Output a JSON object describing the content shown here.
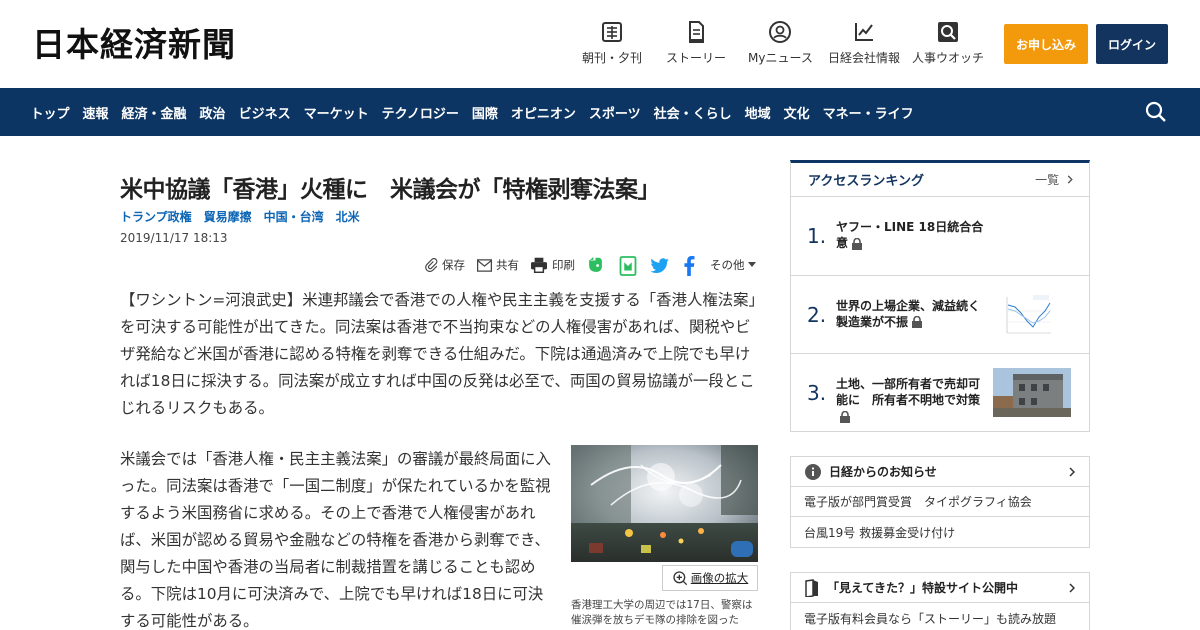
{
  "header": {
    "logo": "日本経済新聞",
    "nav": [
      {
        "label": "朝刊・夕刊",
        "icon": "newspaper-icon"
      },
      {
        "label": "ストーリー",
        "icon": "story-icon"
      },
      {
        "label": "Myニュース",
        "icon": "user-icon"
      },
      {
        "label": "日経会社情報",
        "icon": "chart-icon"
      },
      {
        "label": "人事ウオッチ",
        "icon": "people-search-icon"
      }
    ],
    "apply_label": "お申し込み",
    "login_label": "ログイン"
  },
  "navbar": {
    "items": [
      "トップ",
      "速報",
      "経済・金融",
      "政治",
      "ビジネス",
      "マーケット",
      "テクノロジー",
      "国際",
      "オピニオン",
      "スポーツ",
      "社会・くらし",
      "地域",
      "文化",
      "マネー・ライフ"
    ]
  },
  "article": {
    "title": "米中協議「香港」火種に　米議会が「特権剥奪法案」",
    "tags": [
      "トランプ政権",
      "貿易摩擦",
      "中国・台湾",
      "北米"
    ],
    "date": "2019/11/17 18:13",
    "actions": {
      "save": "保存",
      "share": "共有",
      "print": "印刷",
      "other": "その他"
    },
    "lead": "【ワシントン=河浪武史】米連邦議会で香港での人権や民主主義を支援する「香港人権法案」を可決する可能性が出てきた。同法案は香港で不当拘束などの人権侵害があれば、関税やビザ発給など米国が香港に認める特権を剥奪できる仕組みだ。下院は通過済みで上院でも早ければ18日に採決する。同法案が成立すれば中国の反発は必至で、両国の貿易協議が一段とこじれるリスクもある。",
    "body": "米議会では「香港人権・民主主義法案」の審議が最終局面に入った。同法案は香港で「一国二制度」が保たれているかを監視するよう米国務省に求める。その上で香港で人権侵害があれば、米国が認める貿易や金融などの特権を香港から剥奪でき、関与した中国や香港の当局者に制裁措置を講じることも認める。下院は10月に可決済みで、上院でも早ければ18日に可決する可能性がある。",
    "zoom_label": "画像の拡大",
    "caption": "香港理工大学の周辺では17日、警察は催涙弾を放ちデモ隊の排除を図った"
  },
  "ranking": {
    "title": "アクセスランキング",
    "more": "一覧",
    "items": [
      {
        "num": "1.",
        "text": "ヤフー・LINE 18日統合合意"
      },
      {
        "num": "2.",
        "text": "世界の上場企業、減益続く　製造業が不振"
      },
      {
        "num": "3.",
        "text": "土地、一部所有者で売却可能に　所有者不明地で対策"
      }
    ]
  },
  "notices": {
    "title": "日経からのお知らせ",
    "items": [
      "電子版が部門賞受賞　タイポグラフィ協会",
      "台風19号 救援募金受け付け"
    ]
  },
  "special": {
    "title": "「見えてきた？」特設サイト公開中",
    "items": [
      "電子版有料会員なら「ストーリー」も読み放題"
    ]
  },
  "colors": {
    "navy": "#0c3563",
    "orange": "#f39a0c",
    "link_blue": "#0d65b5"
  }
}
